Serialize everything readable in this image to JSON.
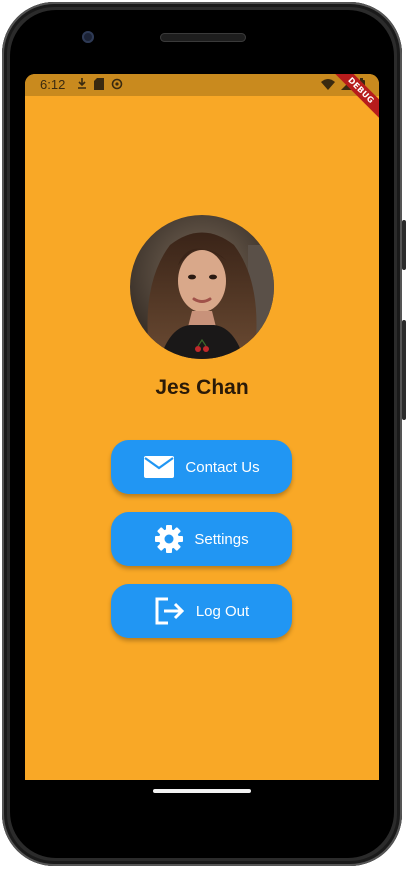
{
  "status_bar": {
    "time": "6:12",
    "left_icons": [
      "download-icon",
      "sd-card-icon",
      "settings-icon"
    ],
    "right_icons": [
      "wifi-icon",
      "signal-icon",
      "battery-icon"
    ]
  },
  "debug_banner": "DEBUG",
  "profile": {
    "name": "Jes Chan"
  },
  "actions": [
    {
      "label": "Contact Us",
      "icon": "mail-icon"
    },
    {
      "label": "Settings",
      "icon": "gear-icon"
    },
    {
      "label": "Log Out",
      "icon": "logout-icon"
    }
  ],
  "colors": {
    "background": "#F9A826",
    "status_bar": "#C98A1E",
    "button": "#2196F3",
    "name_text": "#2a1a08"
  }
}
